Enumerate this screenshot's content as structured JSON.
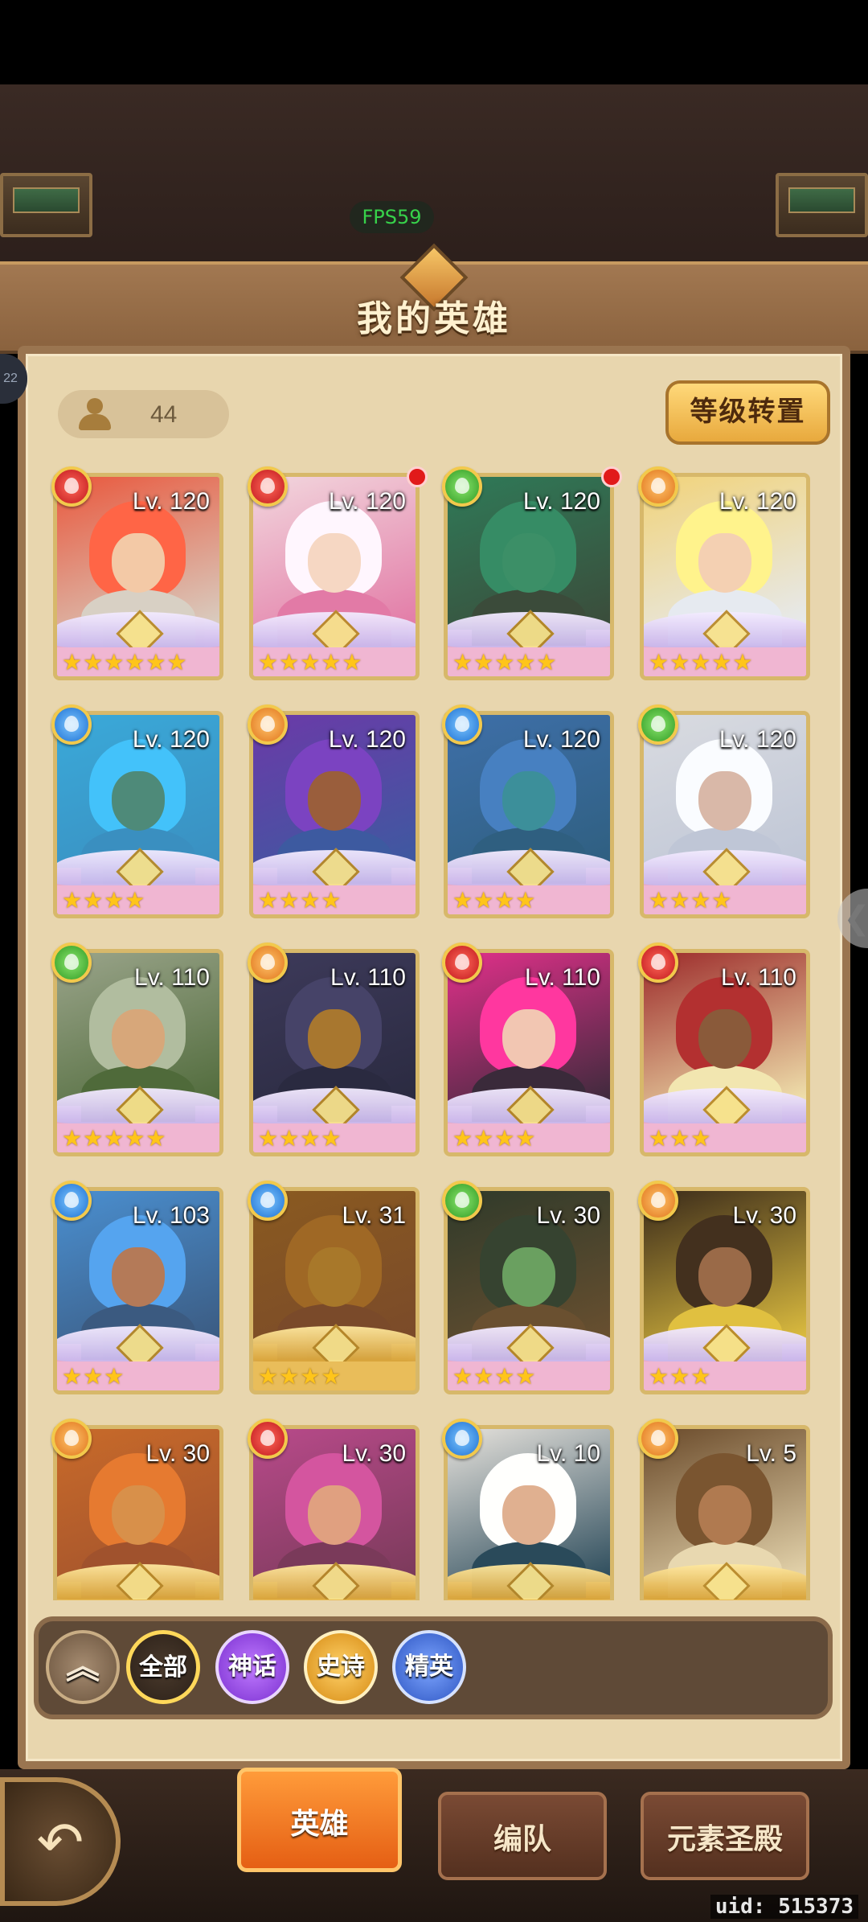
{
  "hud": {
    "fps": "FPS59",
    "uid": "uid: 515373",
    "side_badge": "22",
    "side_arrow": "❮"
  },
  "header": {
    "title": "我的英雄"
  },
  "counter": {
    "hero_count": "44",
    "icon": "person-icon"
  },
  "actions": {
    "level_transfer": "等级转置"
  },
  "heroes": [
    {
      "level": "Lv. 120",
      "element": "fire",
      "stars": "★★★★★★",
      "frame": "pink",
      "new": false,
      "colors": [
        "#e9583d",
        "#f3c9a6",
        "#d8d0c4"
      ]
    },
    {
      "level": "Lv. 120",
      "element": "fire",
      "stars": "★★★★★",
      "frame": "pink",
      "new": true,
      "colors": [
        "#f2d6dd",
        "#f6d7c3",
        "#e27aa6"
      ]
    },
    {
      "level": "Lv. 120",
      "element": "nature",
      "stars": "★★★★★",
      "frame": "pink",
      "new": true,
      "colors": [
        "#2f7a58",
        "#3c8f67",
        "#3b4b3a"
      ]
    },
    {
      "level": "Lv. 120",
      "element": "light",
      "stars": "★★★★★",
      "frame": "pink",
      "new": false,
      "colors": [
        "#f1d37a",
        "#f4d0b2",
        "#e6eaf0"
      ]
    },
    {
      "level": "Lv. 120",
      "element": "water",
      "stars": "★★★★",
      "frame": "pink",
      "new": false,
      "colors": [
        "#3aa9d9",
        "#4e8a79",
        "#3a8fc0"
      ]
    },
    {
      "level": "Lv. 120",
      "element": "light",
      "stars": "★★★★",
      "frame": "pink",
      "new": false,
      "colors": [
        "#6b3aa8",
        "#9a5e3c",
        "#3d5aa0"
      ]
    },
    {
      "level": "Lv. 120",
      "element": "water",
      "stars": "★★★★",
      "frame": "pink",
      "new": false,
      "colors": [
        "#3e6fa8",
        "#3c8f9a",
        "#2f5f80"
      ]
    },
    {
      "level": "Lv. 120",
      "element": "nature",
      "stars": "★★★★",
      "frame": "pink",
      "new": false,
      "colors": [
        "#d9dbe0",
        "#d9b8a8",
        "#bfc6d6"
      ]
    },
    {
      "level": "Lv. 110",
      "element": "nature",
      "stars": "★★★★★",
      "frame": "pink",
      "new": false,
      "colors": [
        "#9aa48a",
        "#d7a77a",
        "#4f6a3a"
      ]
    },
    {
      "level": "Lv. 110",
      "element": "light",
      "stars": "★★★★",
      "frame": "pink",
      "new": false,
      "colors": [
        "#3d3a5a",
        "#a8772f",
        "#2a2a40"
      ]
    },
    {
      "level": "Lv. 110",
      "element": "fire",
      "stars": "★★★★",
      "frame": "pink",
      "new": false,
      "colors": [
        "#e1308a",
        "#f2c6b2",
        "#3a2a3a"
      ]
    },
    {
      "level": "Lv. 110",
      "element": "fire",
      "stars": "★★★",
      "frame": "pink",
      "new": false,
      "colors": [
        "#9c2a2a",
        "#8a5a3a",
        "#f2e6b0"
      ]
    },
    {
      "level": "Lv. 103",
      "element": "water",
      "stars": "★★★",
      "frame": "pink",
      "new": false,
      "colors": [
        "#4a8fd0",
        "#b47a58",
        "#3b5a80"
      ]
    },
    {
      "level": "Lv. 31",
      "element": "water",
      "stars": "★★★★",
      "frame": "gold",
      "new": false,
      "colors": [
        "#8a5a20",
        "#a8782a",
        "#7a4a2a"
      ]
    },
    {
      "level": "Lv. 30",
      "element": "nature",
      "stars": "★★★★",
      "frame": "pink",
      "new": false,
      "colors": [
        "#2f3a2a",
        "#6aa060",
        "#6a5030"
      ]
    },
    {
      "level": "Lv. 30",
      "element": "light",
      "stars": "★★★",
      "frame": "pink",
      "new": false,
      "colors": [
        "#3a2a1a",
        "#9a6a48",
        "#e0c040"
      ]
    },
    {
      "level": "Lv. 30",
      "element": "light",
      "stars": "",
      "frame": "gold",
      "new": false,
      "colors": [
        "#c86a2a",
        "#d8904a",
        "#a0522d"
      ]
    },
    {
      "level": "Lv. 30",
      "element": "fire",
      "stars": "",
      "frame": "gold",
      "new": false,
      "colors": [
        "#b84a8a",
        "#e0a080",
        "#7a3a5a"
      ]
    },
    {
      "level": "Lv. 10",
      "element": "water",
      "stars": "",
      "frame": "gold",
      "new": false,
      "colors": [
        "#e6e2dc",
        "#e0b090",
        "#2a4a5a"
      ]
    },
    {
      "level": "Lv. 5",
      "element": "light",
      "stars": "",
      "frame": "gold",
      "new": false,
      "colors": [
        "#6a4a2a",
        "#b07a50",
        "#e8d8b0"
      ]
    }
  ],
  "filters": {
    "collapse": "︽",
    "all": "全部",
    "myth": "神话",
    "epic": "史诗",
    "elite": "精英"
  },
  "nav": {
    "back": "↶",
    "heroes": "英雄",
    "team": "编队",
    "shrine": "元素圣殿"
  }
}
